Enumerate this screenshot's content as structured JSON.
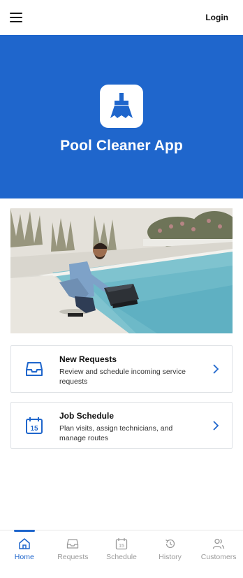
{
  "header": {
    "login_label": "Login",
    "menu_icon": "hamburger-menu-icon"
  },
  "hero": {
    "title": "Pool Cleaner App",
    "logo_icon": "broom-icon",
    "background": "#1f66cc"
  },
  "photo": {
    "alt": "Man kneeling beside a robotic pool cleaner at the edge of a pool"
  },
  "cards": [
    {
      "title": "New Requests",
      "description": "Review and schedule incoming service requests",
      "icon": "inbox-tray-icon"
    },
    {
      "title": "Job Schedule",
      "description": "Plan visits, assign technicians, and manage routes",
      "icon": "calendar-icon",
      "icon_text": "15"
    }
  ],
  "tabs": [
    {
      "label": "Home",
      "icon": "home-icon",
      "active": true
    },
    {
      "label": "Requests",
      "icon": "inbox-tray-icon",
      "active": false
    },
    {
      "label": "Schedule",
      "icon": "calendar-icon",
      "icon_text": "15",
      "active": false
    },
    {
      "label": "History",
      "icon": "history-icon",
      "active": false
    },
    {
      "label": "Customers",
      "icon": "people-icon",
      "active": false
    }
  ],
  "colors": {
    "accent": "#1f66cc",
    "inactive": "#9a9a9a"
  }
}
